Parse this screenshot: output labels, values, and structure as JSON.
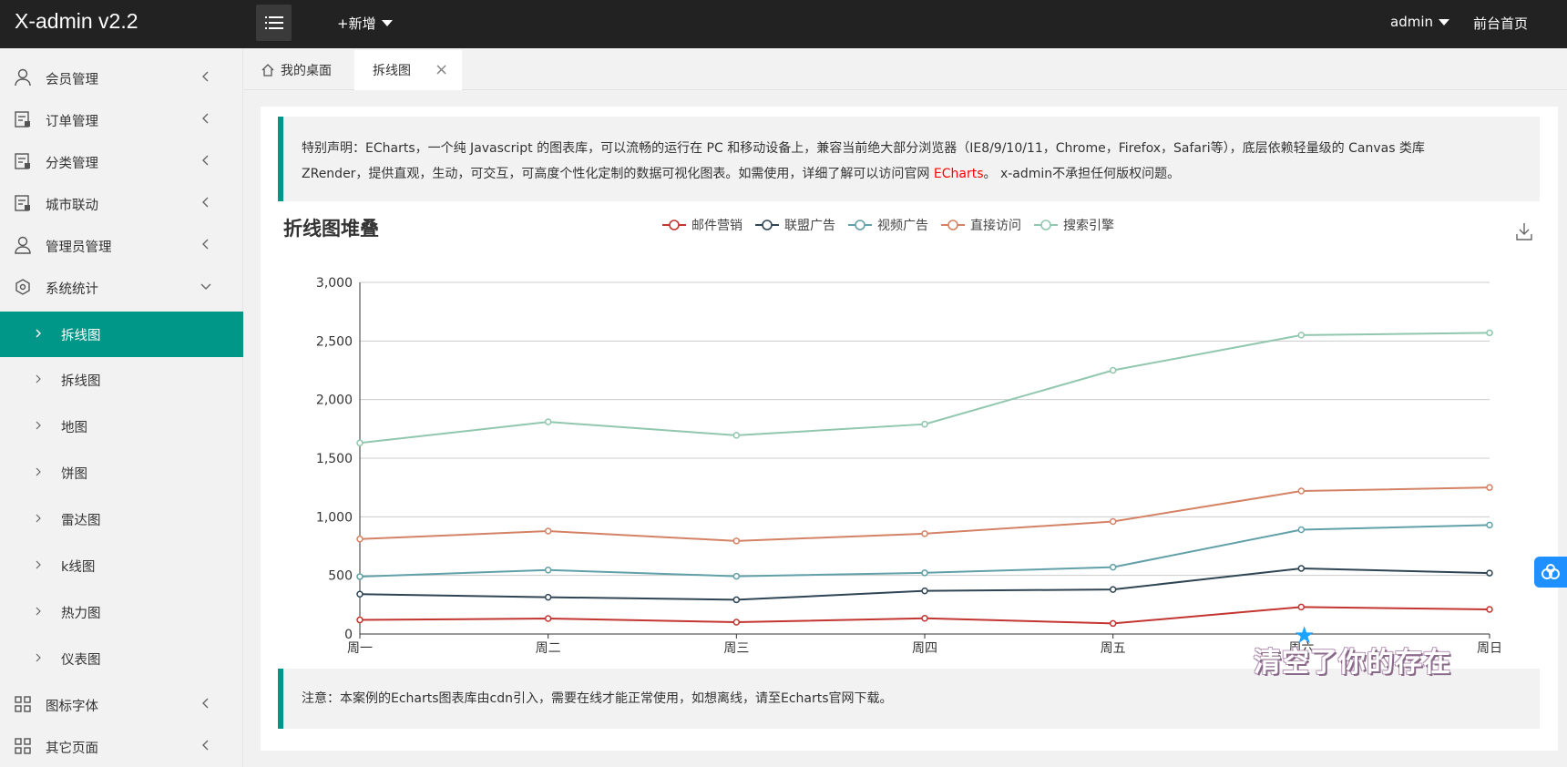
{
  "header": {
    "logo": "X-admin v2.2",
    "add_new": "+新增",
    "user": "admin",
    "front_home": "前台首页"
  },
  "sidebar": {
    "items": [
      {
        "label": "会员管理",
        "icon": "user-icon"
      },
      {
        "label": "订单管理",
        "icon": "order-icon"
      },
      {
        "label": "分类管理",
        "icon": "category-icon"
      },
      {
        "label": "城市联动",
        "icon": "city-icon"
      },
      {
        "label": "管理员管理",
        "icon": "admin-icon"
      },
      {
        "label": "系统统计",
        "icon": "stats-icon"
      }
    ],
    "sub_items": [
      {
        "label": "拆线图",
        "active": true
      },
      {
        "label": "拆线图"
      },
      {
        "label": "地图"
      },
      {
        "label": "饼图"
      },
      {
        "label": "雷达图"
      },
      {
        "label": "k线图"
      },
      {
        "label": "热力图"
      },
      {
        "label": "仪表图"
      }
    ],
    "bottom_items": [
      {
        "label": "图标字体",
        "icon": "grid-icon"
      },
      {
        "label": "其它页面",
        "icon": "grid-icon"
      }
    ]
  },
  "tabs": [
    {
      "label": "我的桌面",
      "icon": "home-icon"
    },
    {
      "label": "拆线图",
      "active": true
    }
  ],
  "notice_top": {
    "line1": "特别声明：ECharts，一个纯 Javascript 的图表库，可以流畅的运行在 PC 和移动设备上，兼容当前绝大部分浏览器（IE8/9/10/11，Chrome，Firefox，Safari等），底层依赖轻量级的 Canvas 类库",
    "line2_pre": "ZRender，提供直观，生动，可交互，可高度个性化定制的数据可视化图表。如需使用，详细了解可以访问官网 ",
    "link": "ECharts",
    "line2_post": "。 x-admin不承担任何版权问题。"
  },
  "notice_bottom": "注意：本案例的Echarts图表库由cdn引入，需要在线才能正常使用，如想离线，请至Echarts官网下载。",
  "watermark": "清空了你的存在",
  "chart_data": {
    "type": "line",
    "title": "折线图堆叠",
    "categories": [
      "周一",
      "周二",
      "周三",
      "周四",
      "周五",
      "周六",
      "周日"
    ],
    "ylim": [
      0,
      3000
    ],
    "yticks": [
      0,
      500,
      1000,
      1500,
      2000,
      2500,
      3000
    ],
    "ytick_labels": [
      "0",
      "500",
      "1,000",
      "1,500",
      "2,000",
      "2,500",
      "3,000"
    ],
    "stacked": true,
    "grid": true,
    "legend_position": "top-center",
    "series": [
      {
        "name": "邮件营销",
        "color": "#c23531",
        "values": [
          120,
          132,
          101,
          134,
          90,
          230,
          210
        ]
      },
      {
        "name": "联盟广告",
        "color": "#2f4554",
        "values": [
          220,
          182,
          191,
          234,
          290,
          330,
          310
        ]
      },
      {
        "name": "视频广告",
        "color": "#61a0a8",
        "values": [
          150,
          232,
          201,
          154,
          190,
          330,
          410
        ]
      },
      {
        "name": "直接访问",
        "color": "#d48265",
        "values": [
          320,
          332,
          301,
          334,
          390,
          330,
          320
        ]
      },
      {
        "name": "搜索引擎",
        "color": "#91c7ae",
        "values": [
          820,
          932,
          901,
          934,
          1290,
          1330,
          1320
        ]
      }
    ]
  }
}
